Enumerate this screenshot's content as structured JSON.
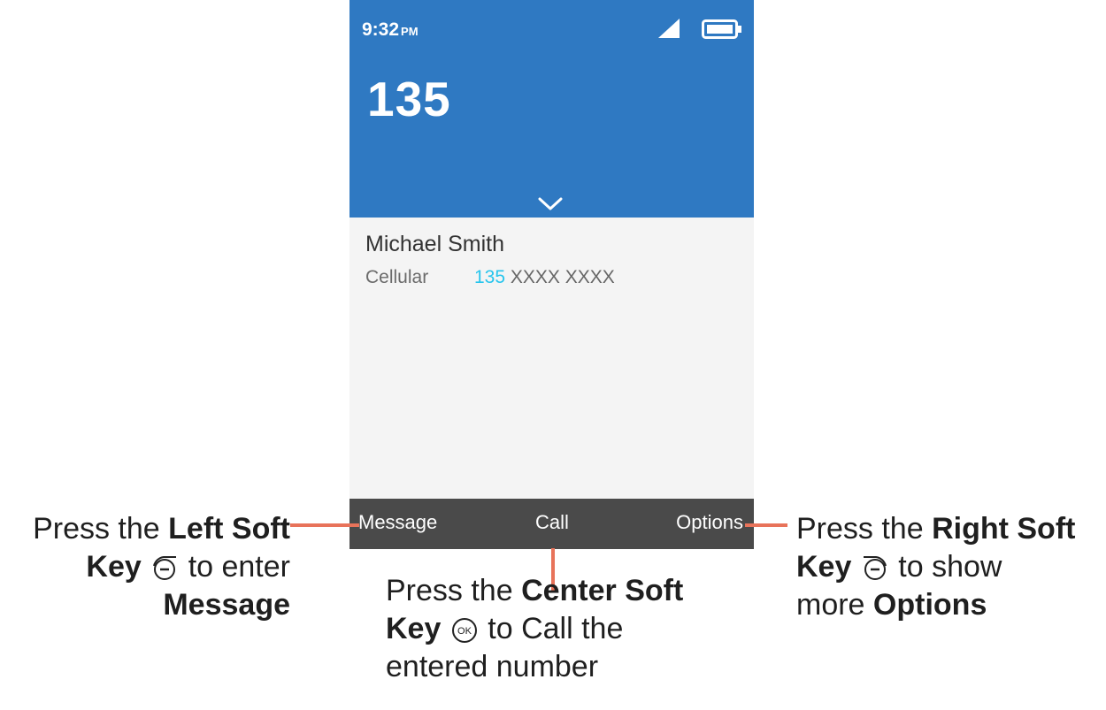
{
  "status_bar": {
    "time": "9:32",
    "ampm": "PM"
  },
  "dialer": {
    "number": "135"
  },
  "contact": {
    "name": "Michael Smith",
    "type": "Cellular",
    "number_match": "135",
    "number_rest": "XXXX XXXX"
  },
  "softkeys": {
    "left": "Message",
    "center": "Call",
    "right": "Options"
  },
  "callouts": {
    "left": {
      "pre": "Press the ",
      "bold1": "Left Soft",
      "bold2": "Key",
      "post": " to enter",
      "bold3": "Message"
    },
    "center": {
      "pre": "Press the ",
      "bold1": "Center Soft",
      "bold2": "Key",
      "post": " to Call the",
      "line3": "entered number"
    },
    "right": {
      "pre": "Press the ",
      "bold1": "Right Soft",
      "bold2": "Key",
      "post": " to show",
      "line3_pre": "more ",
      "bold3": "Options"
    }
  },
  "colors": {
    "header": "#2f79c2",
    "softbar": "#4a4a4a",
    "match": "#27c5ed",
    "leader": "#e8735a"
  },
  "icons": [
    "signal-icon",
    "battery-icon",
    "chevron-down-icon",
    "left-soft-key-icon",
    "ok-key-icon",
    "right-soft-key-icon"
  ]
}
